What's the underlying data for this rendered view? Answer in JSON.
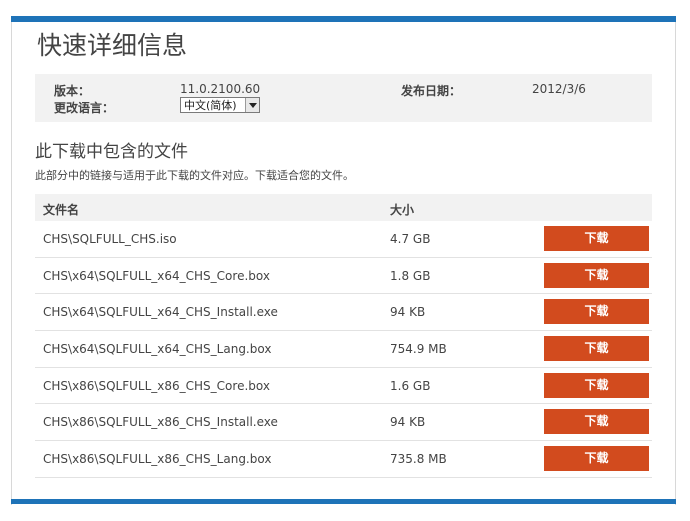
{
  "page": {
    "title": "快速详细信息"
  },
  "details": {
    "version_label": "版本：",
    "version_value": "11.0.2100.60",
    "date_label": "发布日期：",
    "date_value": "2012/3/6",
    "language_label": "更改语言：",
    "language_value": "中文(简体)"
  },
  "files_section": {
    "title": "此下载中包含的文件",
    "description": "此部分中的链接与适用于此下载的文件对应。下载适合您的文件。",
    "columns": {
      "name": "文件名",
      "size": "大小"
    },
    "download_label": "下载",
    "rows": [
      {
        "name": "CHS\\SQLFULL_CHS.iso",
        "size": "4.7 GB"
      },
      {
        "name": "CHS\\x64\\SQLFULL_x64_CHS_Core.box",
        "size": "1.8 GB"
      },
      {
        "name": "CHS\\x64\\SQLFULL_x64_CHS_Install.exe",
        "size": "94 KB"
      },
      {
        "name": "CHS\\x64\\SQLFULL_x64_CHS_Lang.box",
        "size": "754.9 MB"
      },
      {
        "name": "CHS\\x86\\SQLFULL_x86_CHS_Core.box",
        "size": "1.6 GB"
      },
      {
        "name": "CHS\\x86\\SQLFULL_x86_CHS_Install.exe",
        "size": "94 KB"
      },
      {
        "name": "CHS\\x86\\SQLFULL_x86_CHS_Lang.box",
        "size": "735.8 MB"
      }
    ]
  },
  "colors": {
    "accent_bar": "#1e73b8",
    "download_button": "#d24b1e"
  }
}
